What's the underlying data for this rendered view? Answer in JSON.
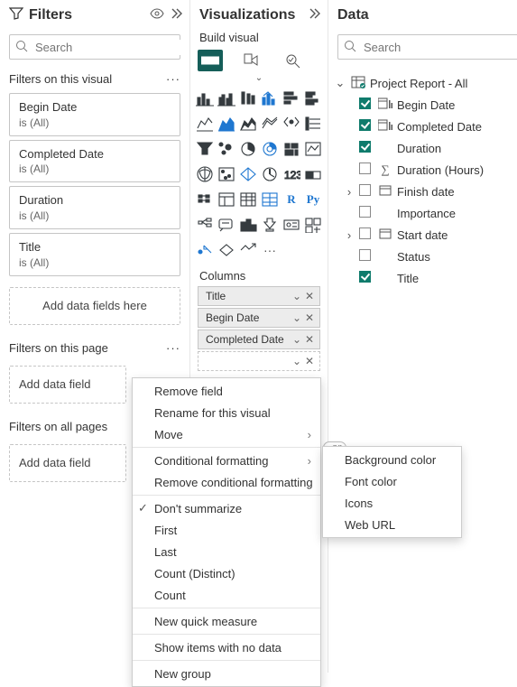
{
  "panes": {
    "filters": {
      "title": "Filters"
    },
    "visualizations": {
      "title": "Visualizations",
      "build_label": "Build visual",
      "columns_label": "Columns"
    },
    "data": {
      "title": "Data"
    }
  },
  "search": {
    "placeholder": "Search"
  },
  "filters_pane": {
    "sections": {
      "visual": "Filters on this visual",
      "page": "Filters on this page",
      "all": "Filters on all pages"
    },
    "cards": [
      {
        "name": "Begin Date",
        "cond": "is (All)"
      },
      {
        "name": "Completed Date",
        "cond": "is (All)"
      },
      {
        "name": "Duration",
        "cond": "is (All)"
      },
      {
        "name": "Title",
        "cond": "is (All)"
      }
    ],
    "dropzone_label": "Add data fields here",
    "dropzone_label_short": "Add data field"
  },
  "columns_well": [
    {
      "label": "Title",
      "dashed": false
    },
    {
      "label": "Begin Date",
      "dashed": false
    },
    {
      "label": "Completed Date",
      "dashed": false
    },
    {
      "label": "",
      "dashed": true
    }
  ],
  "toggle_off": "Off",
  "context_menu": {
    "items": [
      {
        "label": "Remove field"
      },
      {
        "label": "Rename for this visual"
      },
      {
        "label": "Move",
        "submenu": true,
        "sep_after": true
      },
      {
        "label": "Conditional formatting",
        "submenu": true
      },
      {
        "label": "Remove conditional formatting",
        "submenu": true,
        "sep_after": true
      },
      {
        "label": "Don't summarize",
        "checked": true
      },
      {
        "label": "First"
      },
      {
        "label": "Last"
      },
      {
        "label": "Count (Distinct)"
      },
      {
        "label": "Count",
        "sep_after": true
      },
      {
        "label": "New quick measure",
        "sep_after": true
      },
      {
        "label": "Show items with no data",
        "sep_after": true
      },
      {
        "label": "New group"
      }
    ],
    "conditional_submenu": [
      {
        "label": "Background color"
      },
      {
        "label": "Font color"
      },
      {
        "label": "Icons"
      },
      {
        "label": "Web URL"
      }
    ]
  },
  "data_tree": {
    "table": "Project Report - All",
    "fields": [
      {
        "label": "Begin Date",
        "checked": true,
        "icon": "calendar-column",
        "expandable": false
      },
      {
        "label": "Completed Date",
        "checked": true,
        "icon": "calendar-column",
        "expandable": false
      },
      {
        "label": "Duration",
        "checked": true,
        "icon": "",
        "expandable": false
      },
      {
        "label": "Duration (Hours)",
        "checked": false,
        "icon": "sigma",
        "expandable": false
      },
      {
        "label": "Finish date",
        "checked": false,
        "icon": "calendar",
        "expandable": true
      },
      {
        "label": "Importance",
        "checked": false,
        "icon": "",
        "expandable": false
      },
      {
        "label": "Start date",
        "checked": false,
        "icon": "calendar",
        "expandable": true
      },
      {
        "label": "Status",
        "checked": false,
        "icon": "",
        "expandable": false
      },
      {
        "label": "Title",
        "checked": true,
        "icon": "",
        "expandable": false
      }
    ]
  }
}
